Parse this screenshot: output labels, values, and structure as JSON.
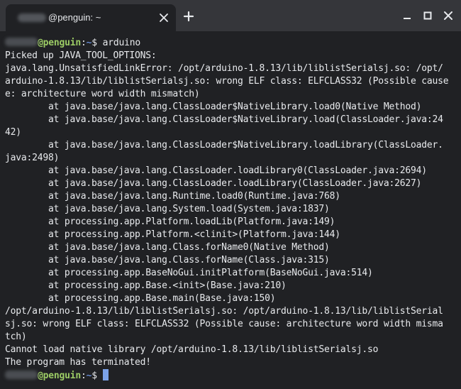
{
  "window": {
    "tab_title": "@penguin: ~"
  },
  "prompt": {
    "host": "@penguin",
    "sep": ":",
    "path": "~",
    "symbol": "$"
  },
  "command": " arduino",
  "output_lines": [
    "Picked up JAVA_TOOL_OPTIONS:",
    "java.lang.UnsatisfiedLinkError: /opt/arduino-1.8.13/lib/liblistSerialsj.so: /opt/",
    "arduino-1.8.13/lib/liblistSerialsj.so: wrong ELF class: ELFCLASS32 (Possible cause",
    "e: architecture word width mismatch)",
    "        at java.base/java.lang.ClassLoader$NativeLibrary.load0(Native Method)",
    "        at java.base/java.lang.ClassLoader$NativeLibrary.load(ClassLoader.java:24",
    "42)",
    "        at java.base/java.lang.ClassLoader$NativeLibrary.loadLibrary(ClassLoader.",
    "java:2498)",
    "        at java.base/java.lang.ClassLoader.loadLibrary0(ClassLoader.java:2694)",
    "        at java.base/java.lang.ClassLoader.loadLibrary(ClassLoader.java:2627)",
    "        at java.base/java.lang.Runtime.load0(Runtime.java:768)",
    "        at java.base/java.lang.System.load(System.java:1837)",
    "        at processing.app.Platform.loadLib(Platform.java:149)",
    "        at processing.app.Platform.<clinit>(Platform.java:144)",
    "        at java.base/java.lang.Class.forName0(Native Method)",
    "        at java.base/java.lang.Class.forName(Class.java:315)",
    "        at processing.app.BaseNoGui.initPlatform(BaseNoGui.java:514)",
    "        at processing.app.Base.<init>(Base.java:210)",
    "        at processing.app.Base.main(Base.java:150)",
    "/opt/arduino-1.8.13/lib/liblistSerialsj.so: /opt/arduino-1.8.13/lib/liblistSerial",
    "sj.so: wrong ELF class: ELFCLASS32 (Possible cause: architecture word width misma",
    "tch)",
    "Cannot load native library /opt/arduino-1.8.13/lib/liblistSerialsj.so",
    "The program has terminated!"
  ],
  "colors": {
    "titlebar": "#35363a",
    "background": "#202124",
    "text": "#e8eaed",
    "host": "#9ccc65",
    "path": "#78a6ff",
    "cursor": "#7ba2e8"
  },
  "icons": {
    "tab_close": "close-icon",
    "new_tab": "plus-icon",
    "minimize": "minimize-icon",
    "maximize": "maximize-icon",
    "close": "close-icon"
  }
}
